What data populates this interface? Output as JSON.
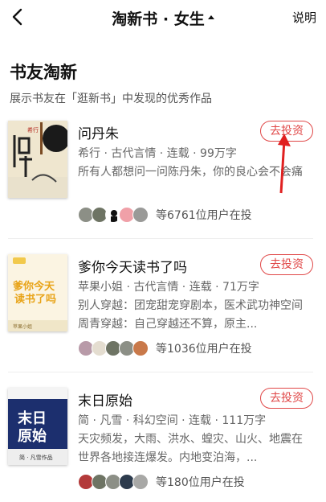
{
  "header": {
    "title": "淘新书 · 女生",
    "explain": "说明"
  },
  "section": {
    "title": "书友淘新",
    "subtitle": "展示书友在「逛新书」中发现的优秀作品"
  },
  "books": [
    {
      "name": "问丹朱",
      "meta": "希行 · 古代言情 · 连载 · 99万字",
      "desc": "所有人都想问一问陈丹朱，你的良心会不会痛",
      "button": "去投资",
      "count": "等6761位用户在投",
      "cover_title": "问丹朱",
      "cover_author": "希行"
    },
    {
      "name": "爹你今天读书了吗",
      "meta": "苹果小姐 · 古代言情 · 连载 · 71万字",
      "desc": "别人穿越：团宠甜宠穿剧本，医术武功神空间周青穿越：自己穿越还不算，原主...",
      "button": "去投资",
      "count": "等1036位用户在投",
      "cover_title": "爹你今天读书了吗",
      "cover_author": "苹果小姐"
    },
    {
      "name": "末日原始",
      "meta": "简 · 凡雪 · 科幻空间 · 连载 · 111万字",
      "desc": "天灾频发，大雨、洪水、蝗灾、山火、地震在世界各地接连爆发。内地变泊海，...",
      "button": "去投资",
      "count": "等180位用户在投",
      "cover_title": "末日原始",
      "cover_author": "简 · 凡雪作品"
    }
  ],
  "colors": {
    "accent": "#e04848",
    "arrow": "#e02020"
  }
}
